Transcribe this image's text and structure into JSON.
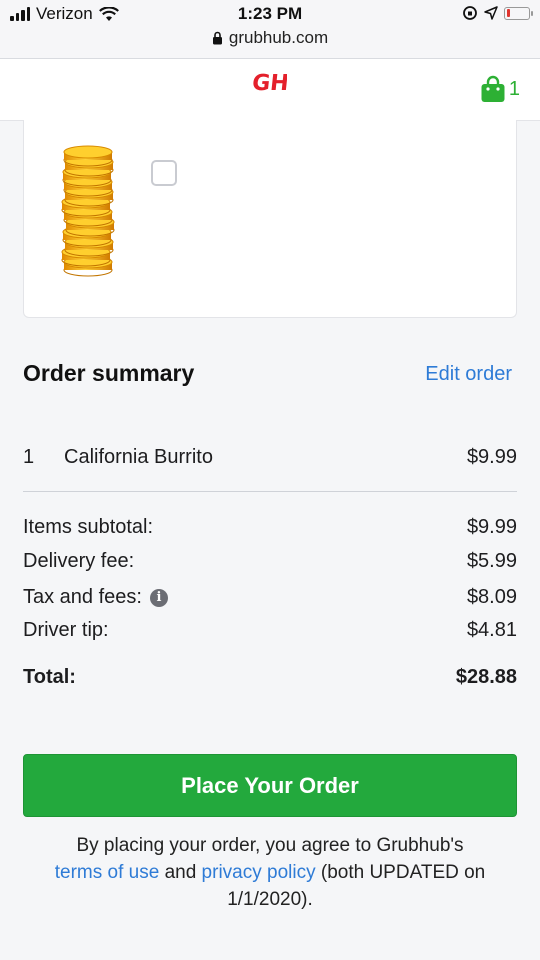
{
  "status_bar": {
    "carrier": "Verizon",
    "time": "1:23 PM",
    "url": "grubhub.com",
    "battery_level": 0.12
  },
  "header": {
    "logo_text": "GH",
    "cart_count": "1",
    "brand_color": "#e4202b",
    "cart_color": "#2db034"
  },
  "item_card": {
    "image": "gold-coins-stack",
    "checkbox_checked": false
  },
  "order_summary": {
    "title": "Order summary",
    "edit_label": "Edit order",
    "items": [
      {
        "qty": "1",
        "name": "California Burrito",
        "price": "$9.99"
      }
    ],
    "fees": [
      {
        "label": "Items subtotal:",
        "value": "$9.99"
      },
      {
        "label": "Delivery fee:",
        "value": "$5.99"
      },
      {
        "label": "Tax and fees:",
        "value": "$8.09",
        "info_icon": "info-icon"
      },
      {
        "label": "Driver tip:",
        "value": "$4.81"
      }
    ],
    "total_label": "Total:",
    "total_value": "$28.88"
  },
  "cta": {
    "label": "Place Your Order",
    "color": "#23a93d"
  },
  "legal": {
    "prefix": "By placing your order, you agree to Grubhub's",
    "terms_link": "terms of use",
    "and": "and",
    "privacy_link": "privacy policy",
    "suffix": "(both UPDATED on 1/1/2020)."
  }
}
